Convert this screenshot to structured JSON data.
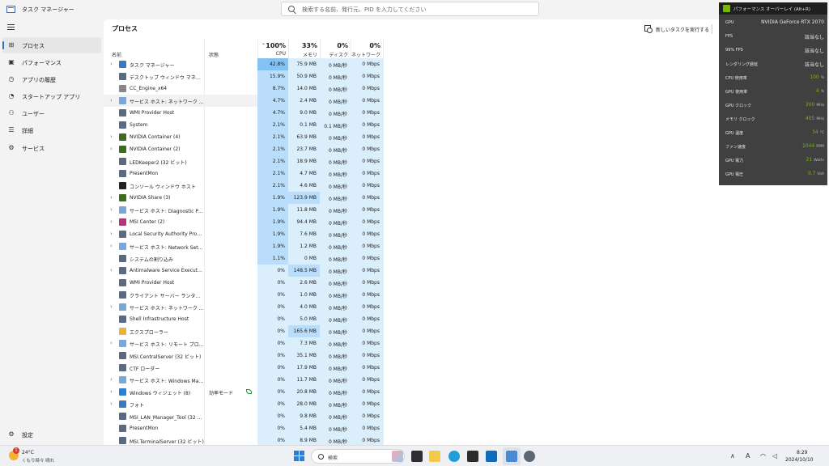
{
  "app": {
    "title": "タスク マネージャー"
  },
  "search": {
    "placeholder": "検索する名前、発行元、PID を入力してください"
  },
  "sidebar": {
    "items": [
      {
        "label": "プロセス",
        "icon": "process-grid-icon",
        "active": true
      },
      {
        "label": "パフォーマンス",
        "icon": "performance-icon"
      },
      {
        "label": "アプリの履歴",
        "icon": "history-icon"
      },
      {
        "label": "スタートアップ アプリ",
        "icon": "startup-icon"
      },
      {
        "label": "ユーザー",
        "icon": "users-icon"
      },
      {
        "label": "詳細",
        "icon": "details-list-icon"
      },
      {
        "label": "サービス",
        "icon": "services-gear-icon"
      }
    ],
    "settings_label": "設定"
  },
  "main": {
    "title": "プロセス",
    "new_task_label": "新しいタスクを実行する"
  },
  "table": {
    "columns": {
      "name": "名前",
      "status": "状態",
      "cpu": {
        "pct": "100%",
        "label": "CPU"
      },
      "memory": {
        "pct": "33%",
        "label": "メモリ"
      },
      "disk": {
        "pct": "0%",
        "label": "ディスク"
      },
      "network": {
        "pct": "0%",
        "label": "ネットワーク"
      }
    },
    "rows": [
      {
        "name": "タスク マネージャー",
        "expand": true,
        "status": "",
        "cpu": "42.8%",
        "mem": "75.9 MB",
        "disk": "0 MB/秒",
        "net": "0 Mbps",
        "cpuLevel": 3,
        "memLevel": 1,
        "iconColor": "#3b78c4"
      },
      {
        "name": "デスクトップ ウィンドウ マネージャー",
        "expand": false,
        "status": "",
        "cpu": "15.9%",
        "mem": "50.9 MB",
        "disk": "0 MB/秒",
        "net": "0 Mbps",
        "cpuLevel": 2,
        "memLevel": 1,
        "iconColor": "#5a6a80"
      },
      {
        "name": "CC_Engine_x64",
        "expand": false,
        "status": "",
        "cpu": "8.7%",
        "mem": "14.0 MB",
        "disk": "0 MB/秒",
        "net": "0 Mbps",
        "cpuLevel": 2,
        "memLevel": 1,
        "iconColor": "#888888"
      },
      {
        "name": "サービス ホスト: ネットワーク サービス",
        "expand": true,
        "status": "",
        "cpu": "4.7%",
        "mem": "2.4 MB",
        "disk": "0 MB/秒",
        "net": "0 Mbps",
        "cpuLevel": 2,
        "memLevel": 1,
        "iconColor": "#7aa7d8",
        "highlight": true
      },
      {
        "name": "WMI Provider Host",
        "expand": false,
        "status": "",
        "cpu": "4.7%",
        "mem": "9.0 MB",
        "disk": "0 MB/秒",
        "net": "0 Mbps",
        "cpuLevel": 2,
        "memLevel": 1,
        "iconColor": "#5a6a80"
      },
      {
        "name": "System",
        "expand": false,
        "status": "",
        "cpu": "2.1%",
        "mem": "0.1 MB",
        "disk": "0.1 MB/秒",
        "net": "0 Mbps",
        "cpuLevel": 2,
        "memLevel": 1,
        "iconColor": "#5a6a80"
      },
      {
        "name": "NVIDIA Container (4)",
        "expand": true,
        "status": "",
        "cpu": "2.1%",
        "mem": "63.9 MB",
        "disk": "0 MB/秒",
        "net": "0 Mbps",
        "cpuLevel": 2,
        "memLevel": 1,
        "iconColor": "#3d6b1f"
      },
      {
        "name": "NVIDIA Container (2)",
        "expand": true,
        "status": "",
        "cpu": "2.1%",
        "mem": "23.7 MB",
        "disk": "0 MB/秒",
        "net": "0 Mbps",
        "cpuLevel": 2,
        "memLevel": 1,
        "iconColor": "#3d6b1f"
      },
      {
        "name": "LEDKeeper2 (32 ビット)",
        "expand": false,
        "status": "",
        "cpu": "2.1%",
        "mem": "18.9 MB",
        "disk": "0 MB/秒",
        "net": "0 Mbps",
        "cpuLevel": 2,
        "memLevel": 1,
        "iconColor": "#5a6a80"
      },
      {
        "name": "PresentMon",
        "expand": false,
        "status": "",
        "cpu": "2.1%",
        "mem": "4.7 MB",
        "disk": "0 MB/秒",
        "net": "0 Mbps",
        "cpuLevel": 2,
        "memLevel": 1,
        "iconColor": "#5a6a80"
      },
      {
        "name": "コンソール ウィンドウ ホスト",
        "expand": false,
        "status": "",
        "cpu": "2.1%",
        "mem": "4.6 MB",
        "disk": "0 MB/秒",
        "net": "0 Mbps",
        "cpuLevel": 2,
        "memLevel": 1,
        "iconColor": "#222222"
      },
      {
        "name": "NVIDIA Share (3)",
        "expand": true,
        "status": "",
        "cpu": "1.9%",
        "mem": "123.9 MB",
        "disk": "0 MB/秒",
        "net": "0 Mbps",
        "cpuLevel": 2,
        "memLevel": 2,
        "iconColor": "#3d6b1f"
      },
      {
        "name": "サービス ホスト: Diagnostic Polic...",
        "expand": true,
        "status": "",
        "cpu": "1.9%",
        "mem": "11.8 MB",
        "disk": "0 MB/秒",
        "net": "0 Mbps",
        "cpuLevel": 2,
        "memLevel": 1,
        "iconColor": "#7aa7d8"
      },
      {
        "name": "MSI Center (2)",
        "expand": true,
        "status": "",
        "cpu": "1.9%",
        "mem": "94.4 MB",
        "disk": "0 MB/秒",
        "net": "0 Mbps",
        "cpuLevel": 2,
        "memLevel": 1,
        "iconColor": "#b0367a"
      },
      {
        "name": "Local Security Authority Proce...",
        "expand": true,
        "status": "",
        "cpu": "1.9%",
        "mem": "7.6 MB",
        "disk": "0 MB/秒",
        "net": "0 Mbps",
        "cpuLevel": 2,
        "memLevel": 1,
        "iconColor": "#5a6a80"
      },
      {
        "name": "サービス ホスト: Network Setup S...",
        "expand": true,
        "status": "",
        "cpu": "1.9%",
        "mem": "1.2 MB",
        "disk": "0 MB/秒",
        "net": "0 Mbps",
        "cpuLevel": 2,
        "memLevel": 1,
        "iconColor": "#7aa7d8"
      },
      {
        "name": "システムの割り込み",
        "expand": false,
        "status": "",
        "cpu": "1.1%",
        "mem": "0 MB",
        "disk": "0 MB/秒",
        "net": "0 Mbps",
        "cpuLevel": 2,
        "memLevel": 1,
        "iconColor": "#5a6a80"
      },
      {
        "name": "Antimalware Service Executable",
        "expand": true,
        "status": "",
        "cpu": "0%",
        "mem": "148.5 MB",
        "disk": "0 MB/秒",
        "net": "0 Mbps",
        "cpuLevel": 1,
        "memLevel": 2,
        "iconColor": "#5a6a80"
      },
      {
        "name": "WMI Provider Host",
        "expand": false,
        "status": "",
        "cpu": "0%",
        "mem": "2.6 MB",
        "disk": "0 MB/秒",
        "net": "0 Mbps",
        "cpuLevel": 1,
        "memLevel": 1,
        "iconColor": "#5a6a80"
      },
      {
        "name": "クライアント サーバー ランタイム プロ...",
        "expand": false,
        "status": "",
        "cpu": "0%",
        "mem": "1.0 MB",
        "disk": "0 MB/秒",
        "net": "0 Mbps",
        "cpuLevel": 1,
        "memLevel": 1,
        "iconColor": "#5a6a80"
      },
      {
        "name": "サービス ホスト: ネットワーク サービス",
        "expand": true,
        "status": "",
        "cpu": "0%",
        "mem": "4.0 MB",
        "disk": "0 MB/秒",
        "net": "0 Mbps",
        "cpuLevel": 1,
        "memLevel": 1,
        "iconColor": "#7aa7d8"
      },
      {
        "name": "Shell Infrastructure Host",
        "expand": false,
        "status": "",
        "cpu": "0%",
        "mem": "5.0 MB",
        "disk": "0 MB/秒",
        "net": "0 Mbps",
        "cpuLevel": 1,
        "memLevel": 1,
        "iconColor": "#5a6a80"
      },
      {
        "name": "エクスプローラー",
        "expand": false,
        "status": "",
        "cpu": "0%",
        "mem": "165.6 MB",
        "disk": "0 MB/秒",
        "net": "0 Mbps",
        "cpuLevel": 1,
        "memLevel": 2,
        "iconColor": "#e8b53a"
      },
      {
        "name": "サービス ホスト: リモート プロシージ...",
        "expand": true,
        "status": "",
        "cpu": "0%",
        "mem": "7.3 MB",
        "disk": "0 MB/秒",
        "net": "0 Mbps",
        "cpuLevel": 1,
        "memLevel": 1,
        "iconColor": "#7aa7d8"
      },
      {
        "name": "MSI.CentralServer (32 ビット)",
        "expand": false,
        "status": "",
        "cpu": "0%",
        "mem": "35.1 MB",
        "disk": "0 MB/秒",
        "net": "0 Mbps",
        "cpuLevel": 1,
        "memLevel": 1,
        "iconColor": "#5a6a80"
      },
      {
        "name": "CTF ローダー",
        "expand": false,
        "status": "",
        "cpu": "0%",
        "mem": "17.9 MB",
        "disk": "0 MB/秒",
        "net": "0 Mbps",
        "cpuLevel": 1,
        "memLevel": 1,
        "iconColor": "#5a6a80"
      },
      {
        "name": "サービス ホスト: Windows Manag...",
        "expand": true,
        "status": "",
        "cpu": "0%",
        "mem": "11.7 MB",
        "disk": "0 MB/秒",
        "net": "0 Mbps",
        "cpuLevel": 1,
        "memLevel": 1,
        "iconColor": "#7aa7d8"
      },
      {
        "name": "Windows ウィジェット (8)",
        "expand": true,
        "status": "効率モード",
        "cpu": "0%",
        "mem": "20.8 MB",
        "disk": "0 MB/秒",
        "net": "0 Mbps",
        "cpuLevel": 1,
        "memLevel": 1,
        "iconColor": "#2b7fd6",
        "leaf": true
      },
      {
        "name": "フォト",
        "expand": true,
        "status": "",
        "cpu": "0%",
        "mem": "28.0 MB",
        "disk": "0 MB/秒",
        "net": "0 Mbps",
        "cpuLevel": 1,
        "memLevel": 1,
        "iconColor": "#3b78c4"
      },
      {
        "name": "MSI_LAN_Manager_Tool (32 ビ...",
        "expand": false,
        "status": "",
        "cpu": "0%",
        "mem": "9.8 MB",
        "disk": "0 MB/秒",
        "net": "0 Mbps",
        "cpuLevel": 1,
        "memLevel": 1,
        "iconColor": "#5a6a80"
      },
      {
        "name": "PresentMon",
        "expand": false,
        "status": "",
        "cpu": "0%",
        "mem": "5.4 MB",
        "disk": "0 MB/秒",
        "net": "0 Mbps",
        "cpuLevel": 1,
        "memLevel": 1,
        "iconColor": "#5a6a80"
      },
      {
        "name": "MSI.TerminalServer (32 ビット)",
        "expand": false,
        "status": "",
        "cpu": "0%",
        "mem": "8.9 MB",
        "disk": "0 MB/秒",
        "net": "0 Mbps",
        "cpuLevel": 1,
        "memLevel": 1,
        "iconColor": "#5a6a80"
      }
    ]
  },
  "overlay": {
    "title": "パフォーマンス オーバーレイ (Alt+R)",
    "rows": [
      {
        "label": "GPU",
        "text": "NVIDIA GeForce RTX 2070"
      },
      {
        "label": "FPS",
        "text": "該当なし"
      },
      {
        "label": "99% FPS",
        "text": "該当なし"
      },
      {
        "label": "レンダリング遅延",
        "text": "該当なし"
      },
      {
        "label": "CPU 使用率",
        "num": "100",
        "unit": "%"
      },
      {
        "label": "GPU 使用率",
        "num": "4",
        "unit": "%"
      },
      {
        "label": "GPU クロック",
        "num": "300",
        "unit": "MHz"
      },
      {
        "label": "メモリ クロック",
        "num": "405",
        "unit": "MHz"
      },
      {
        "label": "GPU 温度",
        "num": "34",
        "unit": "°C"
      },
      {
        "label": "ファン速度",
        "num": "1044",
        "unit": "RPM"
      },
      {
        "label": "GPU 電力",
        "num": "21",
        "unit": "Watts"
      },
      {
        "label": "GPU 電圧",
        "num": "0.7",
        "unit": "Volt"
      }
    ]
  },
  "taskbar": {
    "weather_badge": "1",
    "weather_temp": "24°C",
    "weather_desc": "くもり時々 晴れ",
    "search_label": "検索",
    "ime": "A",
    "time": "8:29",
    "date": "2024/10/10"
  },
  "colors": {
    "accent": "#2a6ec7",
    "heat_high": "#82c2f4",
    "heat_mid": "#b9ddfa",
    "heat_low": "#dbeefc",
    "overlay_value": "#76b900"
  }
}
